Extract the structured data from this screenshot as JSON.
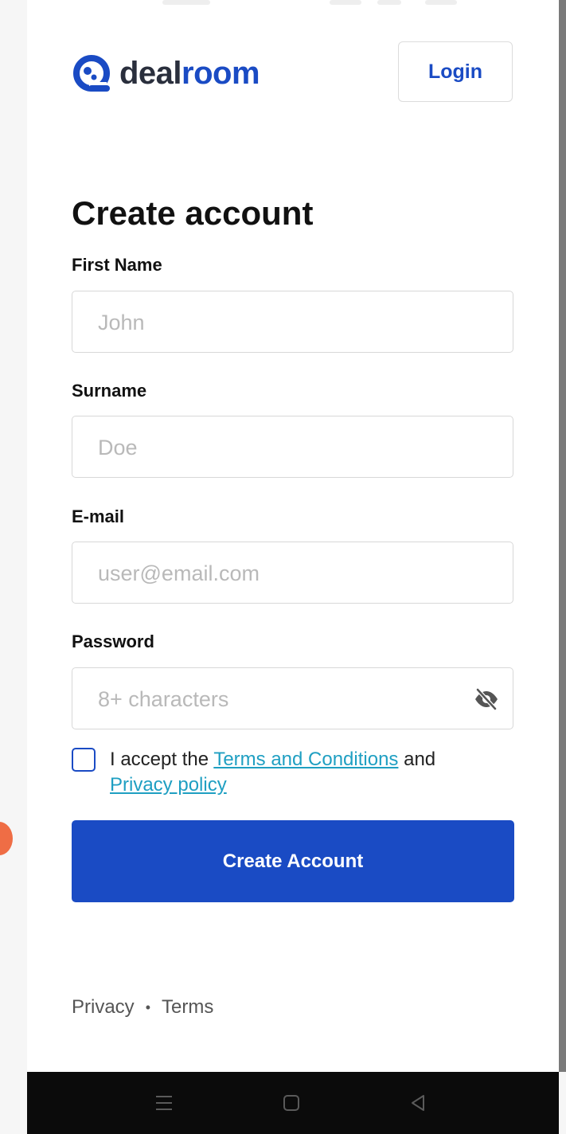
{
  "brand": {
    "part1": "deal",
    "part2": "room",
    "primary_color": "#1a4bc4",
    "dark_color": "#2a2f3d"
  },
  "header": {
    "login_label": "Login"
  },
  "form": {
    "title": "Create account",
    "first_name": {
      "label": "First Name",
      "placeholder": "John"
    },
    "surname": {
      "label": "Surname",
      "placeholder": "Doe"
    },
    "email": {
      "label": "E-mail",
      "placeholder": "user@email.com"
    },
    "password": {
      "label": "Password",
      "placeholder": "8+ characters",
      "toggle_icon": "eye-off-icon"
    },
    "consent": {
      "prefix": "I accept the",
      "terms_link": "Terms and Conditions",
      "conjunction": "and",
      "privacy_link": "Privacy policy",
      "link_color": "#1f9fc2"
    },
    "submit_label": "Create Account"
  },
  "footer": {
    "privacy": "Privacy",
    "separator": "•",
    "terms": "Terms"
  },
  "system_nav": {
    "icons": [
      "menu-icon",
      "home-icon",
      "back-icon"
    ]
  }
}
